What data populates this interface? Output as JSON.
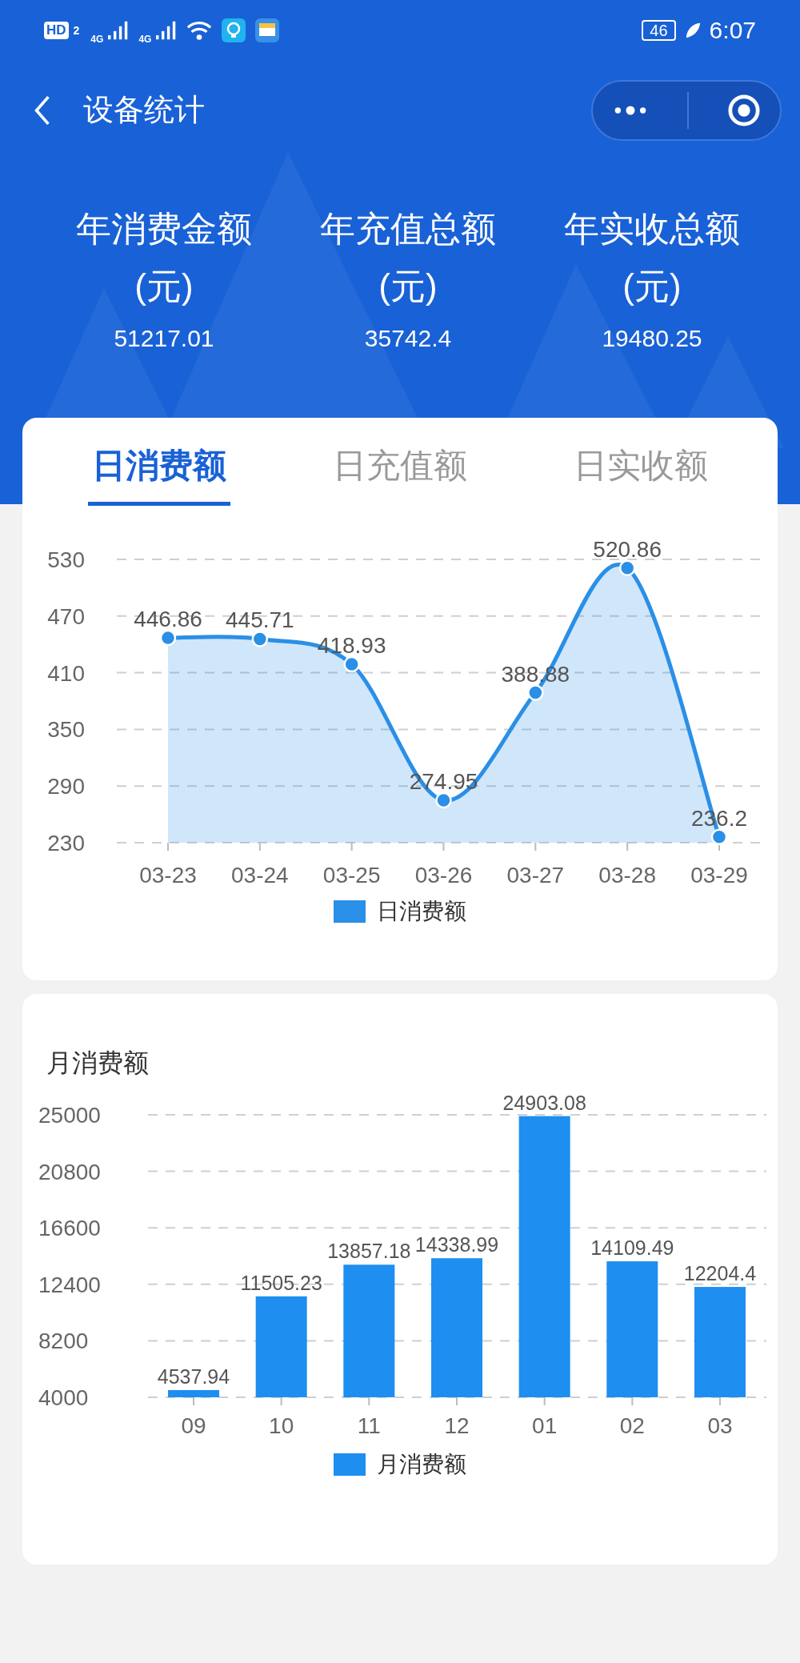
{
  "status_bar": {
    "network_badge": "HD",
    "sim_index": "2",
    "signals": [
      "4G",
      "4G"
    ],
    "battery": "46",
    "time": "6:07"
  },
  "nav": {
    "title": "设备统计"
  },
  "summary": [
    {
      "label": "年消费金额",
      "unit": "(元)",
      "value": "51217.01"
    },
    {
      "label": "年充值总额",
      "unit": "(元)",
      "value": "35742.4"
    },
    {
      "label": "年实收总额",
      "unit": "(元)",
      "value": "19480.25"
    }
  ],
  "tabs": [
    {
      "label": "日消费额",
      "selected": true
    },
    {
      "label": "日充值额",
      "selected": false
    },
    {
      "label": "日实收额",
      "selected": false
    }
  ],
  "daily_chart": {
    "chart_data": {
      "type": "area",
      "categories": [
        "03-23",
        "03-24",
        "03-25",
        "03-26",
        "03-27",
        "03-28",
        "03-29"
      ],
      "series": [
        {
          "name": "日消费额",
          "color": "#2a8fe6",
          "values": [
            446.86,
            445.71,
            418.93,
            274.95,
            388.88,
            520.86,
            236.2
          ]
        }
      ],
      "ylim": [
        230,
        530
      ],
      "yticks": [
        230,
        290,
        350,
        410,
        470,
        530
      ],
      "grid": true,
      "data_labels": true
    }
  },
  "monthly": {
    "title": "月消费额",
    "chart_data": {
      "type": "bar",
      "categories": [
        "09",
        "10",
        "11",
        "12",
        "01",
        "02",
        "03"
      ],
      "series": [
        {
          "name": "月消费额",
          "color": "#1e8ef0",
          "values": [
            4537.94,
            11505.23,
            13857.18,
            14338.99,
            24903.08,
            14109.49,
            12204.44
          ]
        }
      ],
      "ylim": [
        4000,
        25000
      ],
      "yticks": [
        4000,
        8200,
        12400,
        16600,
        20800,
        25000
      ],
      "grid": true,
      "value_labels": [
        "4537.94",
        "11505.23",
        "13857.18",
        "14338.99",
        "24903.08",
        "14109.49",
        "12204.4"
      ]
    }
  }
}
